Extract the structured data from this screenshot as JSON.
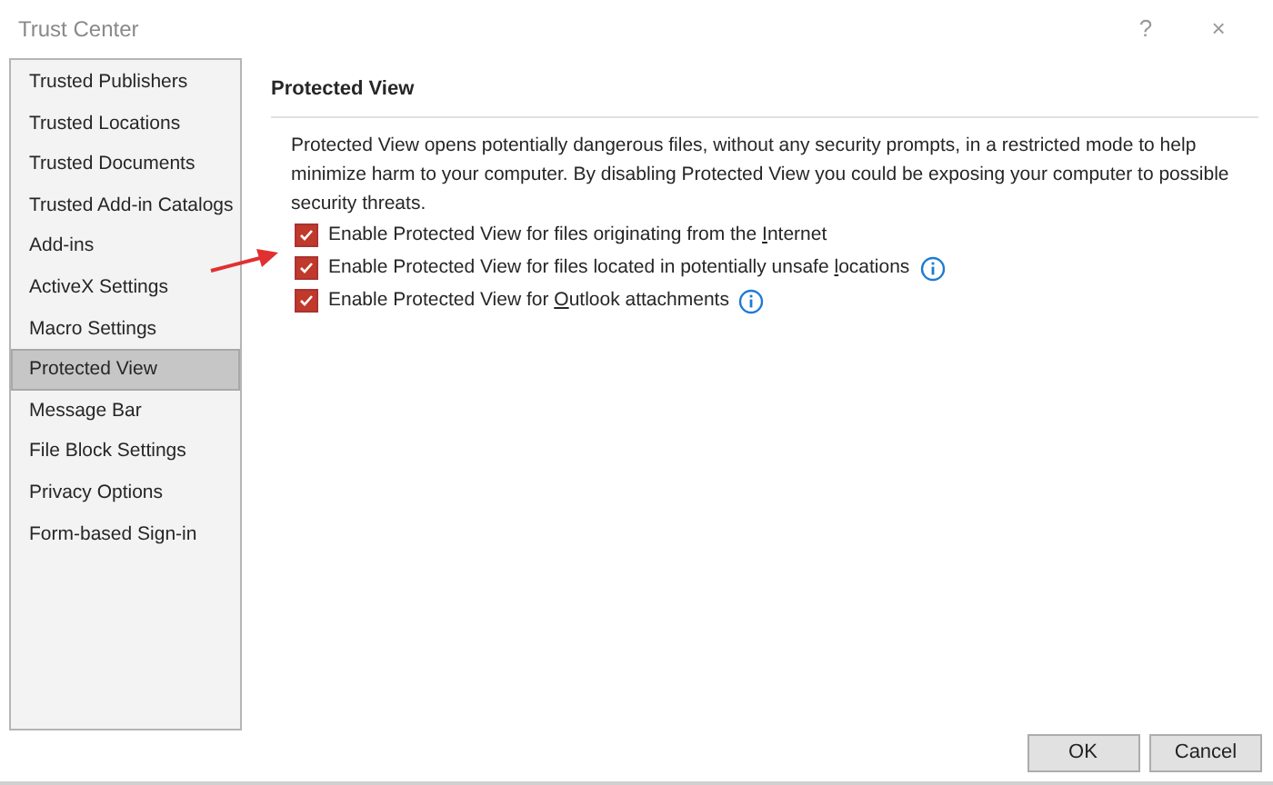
{
  "window": {
    "title": "Trust Center",
    "help": "?",
    "close": "×"
  },
  "sidebar": {
    "items": [
      {
        "label": "Trusted Publishers",
        "selected": false
      },
      {
        "label": "Trusted Locations",
        "selected": false
      },
      {
        "label": "Trusted Documents",
        "selected": false
      },
      {
        "label": "Trusted Add-in Catalogs",
        "selected": false
      },
      {
        "label": "Add-ins",
        "selected": false
      },
      {
        "label": "ActiveX Settings",
        "selected": false
      },
      {
        "label": "Macro Settings",
        "selected": false
      },
      {
        "label": "Protected View",
        "selected": true
      },
      {
        "label": "Message Bar",
        "selected": false
      },
      {
        "label": "File Block Settings",
        "selected": false
      },
      {
        "label": "Privacy Options",
        "selected": false
      },
      {
        "label": "Form-based Sign-in",
        "selected": false
      }
    ]
  },
  "section": {
    "heading": "Protected View",
    "description": "Protected View opens potentially dangerous files, without any security prompts, in a restricted mode to help minimize harm to your computer. By disabling Protected View you could be exposing your computer to possible security threats.",
    "options": [
      {
        "before": "Enable Protected View for files originating from the ",
        "access_key": "I",
        "after": "nternet",
        "checked": true,
        "info": false,
        "highlighted": false
      },
      {
        "before": "Enable Protected View for files located in potentially unsafe ",
        "access_key": "l",
        "after": "ocations",
        "checked": true,
        "info": true,
        "highlighted": true
      },
      {
        "before": "Enable Protected View for ",
        "access_key": "O",
        "after": "utlook attachments",
        "checked": true,
        "info": true,
        "highlighted": false
      }
    ]
  },
  "buttons": [
    "OK",
    "Cancel"
  ]
}
